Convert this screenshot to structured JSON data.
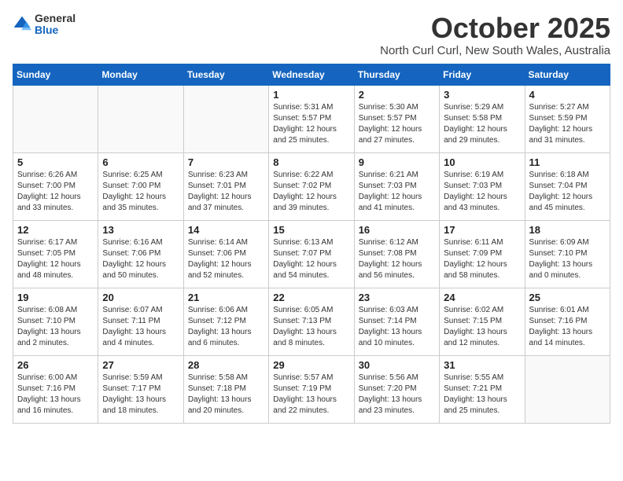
{
  "logo": {
    "general": "General",
    "blue": "Blue"
  },
  "title": "October 2025",
  "location": "North Curl Curl, New South Wales, Australia",
  "days_of_week": [
    "Sunday",
    "Monday",
    "Tuesday",
    "Wednesday",
    "Thursday",
    "Friday",
    "Saturday"
  ],
  "weeks": [
    [
      {
        "day": "",
        "info": ""
      },
      {
        "day": "",
        "info": ""
      },
      {
        "day": "",
        "info": ""
      },
      {
        "day": "1",
        "info": "Sunrise: 5:31 AM\nSunset: 5:57 PM\nDaylight: 12 hours\nand 25 minutes."
      },
      {
        "day": "2",
        "info": "Sunrise: 5:30 AM\nSunset: 5:57 PM\nDaylight: 12 hours\nand 27 minutes."
      },
      {
        "day": "3",
        "info": "Sunrise: 5:29 AM\nSunset: 5:58 PM\nDaylight: 12 hours\nand 29 minutes."
      },
      {
        "day": "4",
        "info": "Sunrise: 5:27 AM\nSunset: 5:59 PM\nDaylight: 12 hours\nand 31 minutes."
      }
    ],
    [
      {
        "day": "5",
        "info": "Sunrise: 6:26 AM\nSunset: 7:00 PM\nDaylight: 12 hours\nand 33 minutes."
      },
      {
        "day": "6",
        "info": "Sunrise: 6:25 AM\nSunset: 7:00 PM\nDaylight: 12 hours\nand 35 minutes."
      },
      {
        "day": "7",
        "info": "Sunrise: 6:23 AM\nSunset: 7:01 PM\nDaylight: 12 hours\nand 37 minutes."
      },
      {
        "day": "8",
        "info": "Sunrise: 6:22 AM\nSunset: 7:02 PM\nDaylight: 12 hours\nand 39 minutes."
      },
      {
        "day": "9",
        "info": "Sunrise: 6:21 AM\nSunset: 7:03 PM\nDaylight: 12 hours\nand 41 minutes."
      },
      {
        "day": "10",
        "info": "Sunrise: 6:19 AM\nSunset: 7:03 PM\nDaylight: 12 hours\nand 43 minutes."
      },
      {
        "day": "11",
        "info": "Sunrise: 6:18 AM\nSunset: 7:04 PM\nDaylight: 12 hours\nand 45 minutes."
      }
    ],
    [
      {
        "day": "12",
        "info": "Sunrise: 6:17 AM\nSunset: 7:05 PM\nDaylight: 12 hours\nand 48 minutes."
      },
      {
        "day": "13",
        "info": "Sunrise: 6:16 AM\nSunset: 7:06 PM\nDaylight: 12 hours\nand 50 minutes."
      },
      {
        "day": "14",
        "info": "Sunrise: 6:14 AM\nSunset: 7:06 PM\nDaylight: 12 hours\nand 52 minutes."
      },
      {
        "day": "15",
        "info": "Sunrise: 6:13 AM\nSunset: 7:07 PM\nDaylight: 12 hours\nand 54 minutes."
      },
      {
        "day": "16",
        "info": "Sunrise: 6:12 AM\nSunset: 7:08 PM\nDaylight: 12 hours\nand 56 minutes."
      },
      {
        "day": "17",
        "info": "Sunrise: 6:11 AM\nSunset: 7:09 PM\nDaylight: 12 hours\nand 58 minutes."
      },
      {
        "day": "18",
        "info": "Sunrise: 6:09 AM\nSunset: 7:10 PM\nDaylight: 13 hours\nand 0 minutes."
      }
    ],
    [
      {
        "day": "19",
        "info": "Sunrise: 6:08 AM\nSunset: 7:10 PM\nDaylight: 13 hours\nand 2 minutes."
      },
      {
        "day": "20",
        "info": "Sunrise: 6:07 AM\nSunset: 7:11 PM\nDaylight: 13 hours\nand 4 minutes."
      },
      {
        "day": "21",
        "info": "Sunrise: 6:06 AM\nSunset: 7:12 PM\nDaylight: 13 hours\nand 6 minutes."
      },
      {
        "day": "22",
        "info": "Sunrise: 6:05 AM\nSunset: 7:13 PM\nDaylight: 13 hours\nand 8 minutes."
      },
      {
        "day": "23",
        "info": "Sunrise: 6:03 AM\nSunset: 7:14 PM\nDaylight: 13 hours\nand 10 minutes."
      },
      {
        "day": "24",
        "info": "Sunrise: 6:02 AM\nSunset: 7:15 PM\nDaylight: 13 hours\nand 12 minutes."
      },
      {
        "day": "25",
        "info": "Sunrise: 6:01 AM\nSunset: 7:16 PM\nDaylight: 13 hours\nand 14 minutes."
      }
    ],
    [
      {
        "day": "26",
        "info": "Sunrise: 6:00 AM\nSunset: 7:16 PM\nDaylight: 13 hours\nand 16 minutes."
      },
      {
        "day": "27",
        "info": "Sunrise: 5:59 AM\nSunset: 7:17 PM\nDaylight: 13 hours\nand 18 minutes."
      },
      {
        "day": "28",
        "info": "Sunrise: 5:58 AM\nSunset: 7:18 PM\nDaylight: 13 hours\nand 20 minutes."
      },
      {
        "day": "29",
        "info": "Sunrise: 5:57 AM\nSunset: 7:19 PM\nDaylight: 13 hours\nand 22 minutes."
      },
      {
        "day": "30",
        "info": "Sunrise: 5:56 AM\nSunset: 7:20 PM\nDaylight: 13 hours\nand 23 minutes."
      },
      {
        "day": "31",
        "info": "Sunrise: 5:55 AM\nSunset: 7:21 PM\nDaylight: 13 hours\nand 25 minutes."
      },
      {
        "day": "",
        "info": ""
      }
    ]
  ]
}
